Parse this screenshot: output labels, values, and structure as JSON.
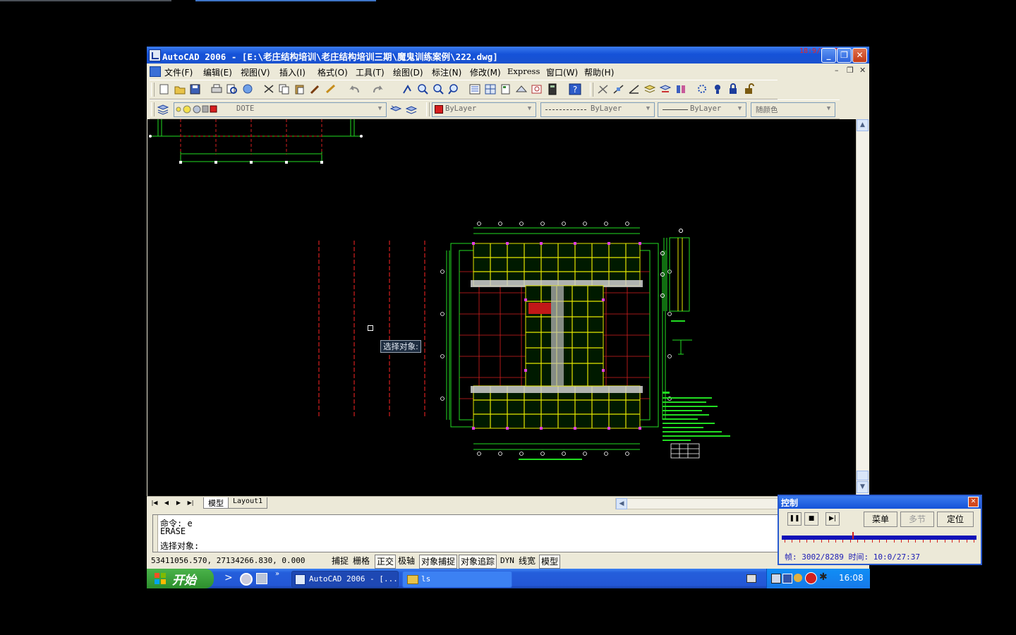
{
  "window": {
    "title": "AutoCAD 2006 - [E:\\老庄结构培训\\老庄结构培训三期\\魔鬼训练案例\\222.dwg]",
    "overlay_text": "18:9/7:37"
  },
  "menu": {
    "items": [
      "文件(F)",
      "编辑(E)",
      "视图(V)",
      "插入(I)",
      "格式(O)",
      "工具(T)",
      "绘图(D)",
      "标注(N)",
      "修改(M)",
      "Express",
      "窗口(W)",
      "帮助(H)"
    ]
  },
  "layers_toolbar": {
    "layer_name": "DOTE",
    "color": "ByLayer",
    "linetype": "ByLayer",
    "lineweight": "ByLayer",
    "plot_style": "随颜色"
  },
  "tabs": [
    "模型",
    "Layout1"
  ],
  "command": {
    "line1": "命令: e",
    "line2": "ERASE",
    "line3": "选择对象:"
  },
  "tooltip": "选择对象:",
  "status": {
    "coords": "53411056.570, 27134266.830, 0.000",
    "toggles": [
      "捕捉",
      "栅格",
      "正交",
      "极轴",
      "对象捕捉",
      "对象追踪",
      "DYN",
      "线宽",
      "模型"
    ]
  },
  "taskbar": {
    "start": "开始",
    "tasks": [
      "AutoCAD 2006 - [...",
      "ls"
    ],
    "clock": "16:08"
  },
  "player": {
    "title": "控制",
    "buttons": [
      "菜单",
      "多节",
      "定位"
    ],
    "frame_info": "帧: 3002/8289 时间: 10:0/27:37",
    "progress": 0.362
  },
  "colors": {
    "accent": "#245edb",
    "cad_green": "#22dd22",
    "cad_red": "#d61f1f",
    "cad_yellow": "#e6e600"
  }
}
